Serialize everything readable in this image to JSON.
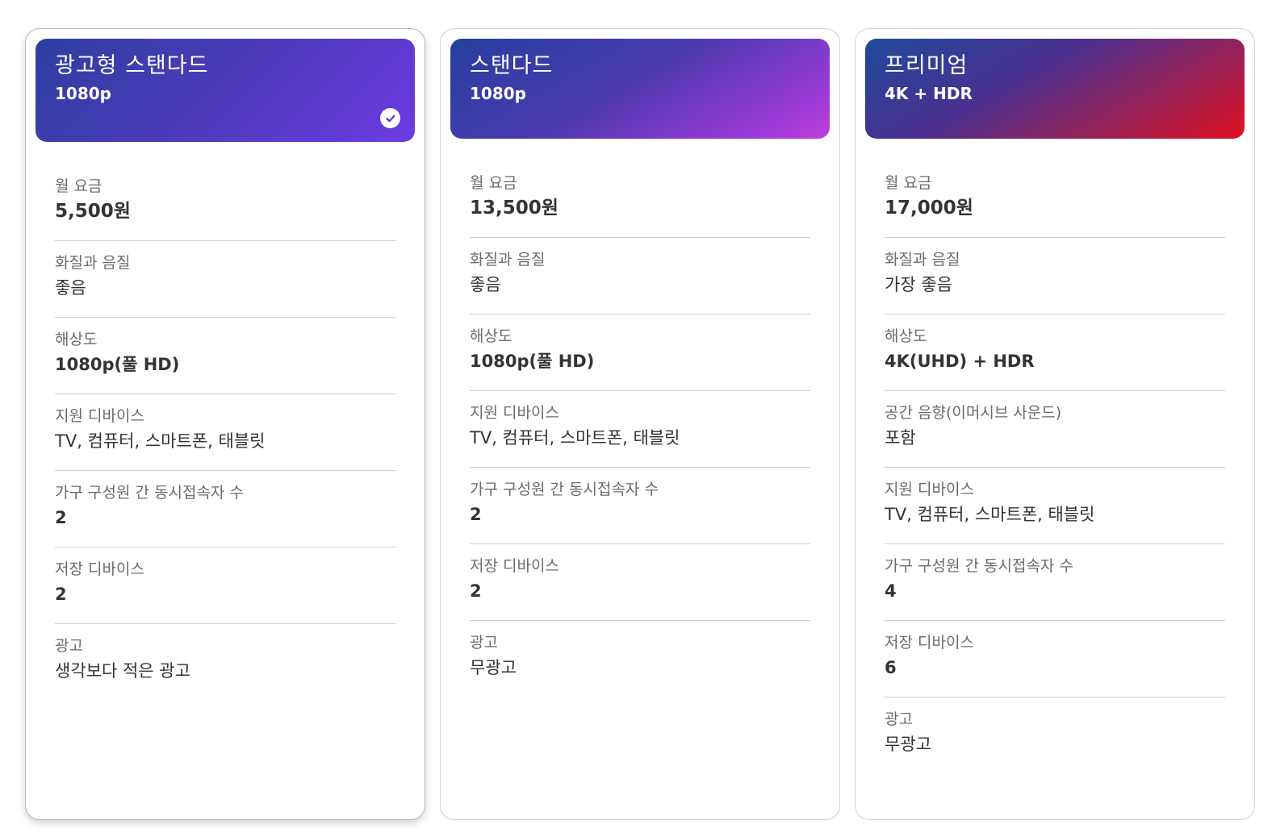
{
  "plans": [
    {
      "name": "광고형 스탠다드",
      "resolution": "1080p",
      "selected": true,
      "rows": [
        {
          "label": "월 요금",
          "value": "5,500원"
        },
        {
          "label": "화질과 음질",
          "value": "좋음"
        },
        {
          "label": "해상도",
          "value": "1080p(풀 HD)"
        },
        {
          "label": "지원 디바이스",
          "value": "TV, 컴퓨터, 스마트폰, 태블릿"
        },
        {
          "label": "가구 구성원 간 동시접속자 수",
          "value": "2"
        },
        {
          "label": "저장 디바이스",
          "value": "2"
        },
        {
          "label": "광고",
          "value": "생각보다 적은 광고"
        }
      ]
    },
    {
      "name": "스탠다드",
      "resolution": "1080p",
      "selected": false,
      "rows": [
        {
          "label": "월 요금",
          "value": "13,500원"
        },
        {
          "label": "화질과 음질",
          "value": "좋음"
        },
        {
          "label": "해상도",
          "value": "1080p(풀 HD)"
        },
        {
          "label": "지원 디바이스",
          "value": "TV, 컴퓨터, 스마트폰, 태블릿"
        },
        {
          "label": "가구 구성원 간 동시접속자 수",
          "value": "2"
        },
        {
          "label": "저장 디바이스",
          "value": "2"
        },
        {
          "label": "광고",
          "value": "무광고"
        }
      ]
    },
    {
      "name": "프리미엄",
      "resolution": "4K + HDR",
      "selected": false,
      "rows": [
        {
          "label": "월 요금",
          "value": "17,000원"
        },
        {
          "label": "화질과 음질",
          "value": "가장 좋음"
        },
        {
          "label": "해상도",
          "value": "4K(UHD) + HDR"
        },
        {
          "label": "공간 음향(이머시브 사운드)",
          "value": "포함"
        },
        {
          "label": "지원 디바이스",
          "value": "TV, 컴퓨터, 스마트폰, 태블릿"
        },
        {
          "label": "가구 구성원 간 동시접속자 수",
          "value": "4"
        },
        {
          "label": "저장 디바이스",
          "value": "6"
        },
        {
          "label": "광고",
          "value": "무광고"
        }
      ]
    }
  ],
  "icons": {
    "selected": "check-circle-icon"
  },
  "colors": {
    "check": "#4b3bd0",
    "divider": "#cfcfcf"
  }
}
